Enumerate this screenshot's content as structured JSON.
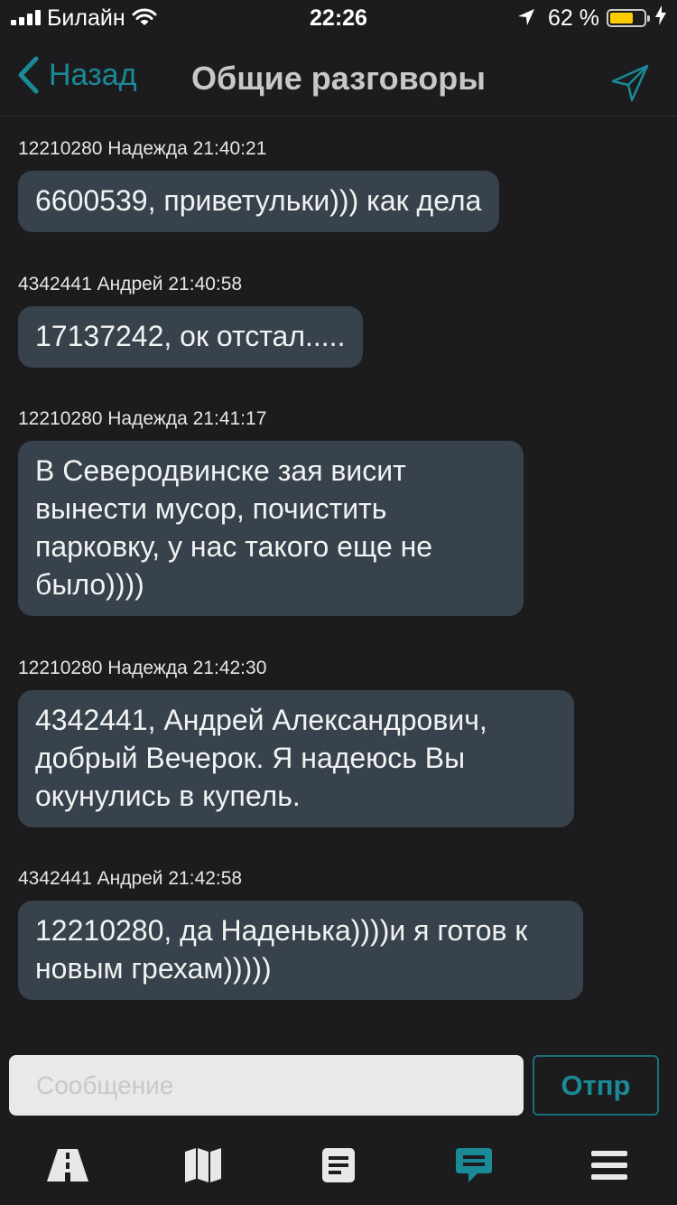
{
  "status_bar": {
    "carrier": "Билайн",
    "time": "22:26",
    "battery": "62 %",
    "battery_level": 0.62
  },
  "nav": {
    "back_label": "Назад",
    "title": "Общие разговоры"
  },
  "messages": [
    {
      "meta": "12210280 Надежда 21:40:21",
      "text": "6600539, приветульки))) как дела"
    },
    {
      "meta": "4342441 Андрей 21:40:58",
      "text": "17137242, ок отстал....."
    },
    {
      "meta": "12210280 Надежда 21:41:17",
      "text": "В Северодвинске зая висит вынести мусор, почистить парковку, у нас такого еще не было))))"
    },
    {
      "meta": "12210280 Надежда 21:42:30",
      "text": "4342441, Андрей Александрович, добрый Вечерок. Я надеюсь Вы окунулись в купель."
    },
    {
      "meta": "4342441 Андрей 21:42:58",
      "text": "12210280, да Наденька))))и я готов к новым грехам)))))"
    }
  ],
  "composer": {
    "placeholder": "Сообщение",
    "send_label": "Отпр"
  },
  "tabs": [
    {
      "icon": "road-icon",
      "active": false
    },
    {
      "icon": "map-icon",
      "active": false
    },
    {
      "icon": "document-icon",
      "active": false
    },
    {
      "icon": "chat-icon",
      "active": true
    },
    {
      "icon": "menu-icon",
      "active": false
    }
  ],
  "colors": {
    "accent": "#1a8a97",
    "bubble": "#37424c",
    "background": "#1c1c1e"
  }
}
